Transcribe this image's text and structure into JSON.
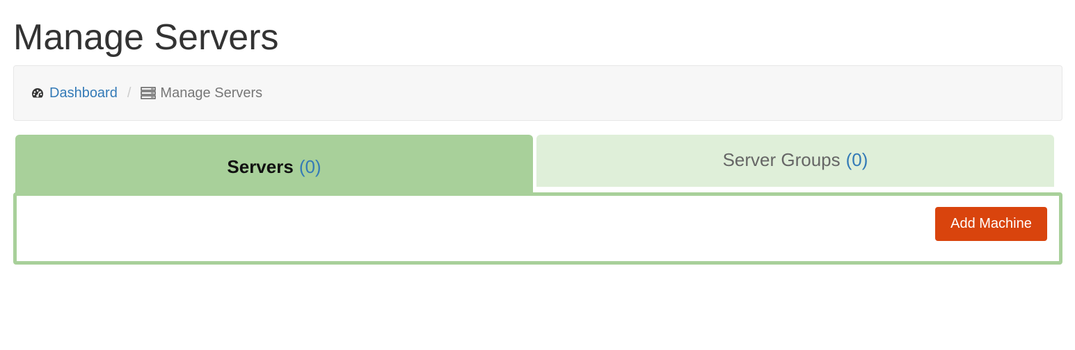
{
  "page": {
    "title": "Manage Servers"
  },
  "breadcrumb": {
    "items": [
      {
        "label": "Dashboard",
        "icon": "dashboard-icon",
        "link": true
      },
      {
        "label": "Manage Servers",
        "icon": "server-icon",
        "link": false
      }
    ],
    "separator": "/"
  },
  "tabs": [
    {
      "label": "Servers",
      "count": "(0)",
      "active": true
    },
    {
      "label": "Server Groups",
      "count": "(0)",
      "active": false
    }
  ],
  "panel": {
    "add_button_label": "Add Machine"
  },
  "colors": {
    "tab_active": "#a8d09a",
    "tab_inactive": "#dfefd9",
    "link": "#337ab7",
    "button": "#d9440d"
  }
}
